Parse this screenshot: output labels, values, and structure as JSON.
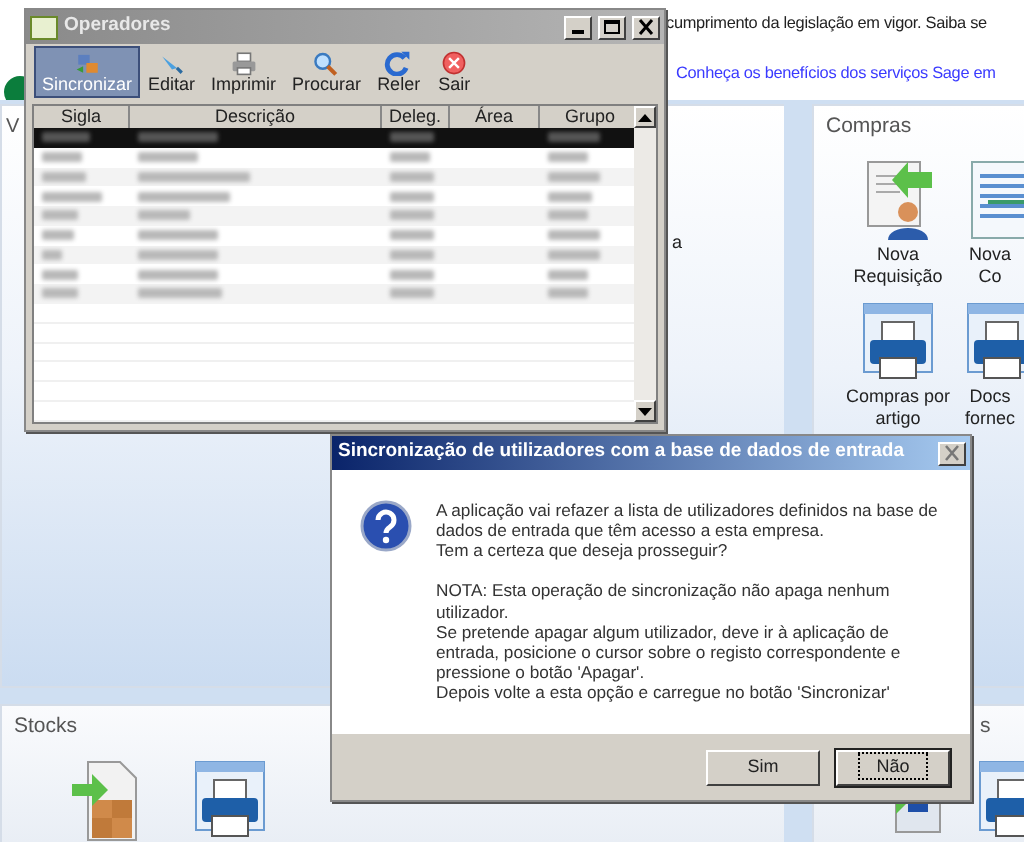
{
  "page": {
    "notice": "cumprimento da legislação em vigor. Saiba se",
    "link": "Conheça os benefícios dos serviços Sage em"
  },
  "panels": [
    {
      "title": "V",
      "items": [
        {
          "label": "a",
          "kind": "text"
        }
      ]
    },
    {
      "title": "Compras",
      "items": [
        {
          "label": "Nova Requisição",
          "kind": "request"
        },
        {
          "label": "Nova Co",
          "kind": "list"
        },
        {
          "label": "Compras por artigo",
          "kind": "printer"
        },
        {
          "label": "Docs fornec",
          "kind": "printer"
        }
      ]
    },
    {
      "title": "Stocks",
      "items": [
        {
          "kind": "stock"
        },
        {
          "kind": "printer"
        }
      ]
    },
    {
      "title": "s",
      "items": [
        {
          "kind": "warehouse"
        },
        {
          "kind": "printer"
        }
      ]
    }
  ],
  "operators_window": {
    "title": "Operadores",
    "toolbar": [
      {
        "label": "Sincronizar",
        "kind": "sync",
        "selected": true
      },
      {
        "label": "Editar",
        "kind": "edit",
        "selected": false
      },
      {
        "label": "Imprimir",
        "kind": "print",
        "selected": false
      },
      {
        "label": "Procurar",
        "kind": "search",
        "selected": false
      },
      {
        "label": "Reler",
        "kind": "reload",
        "selected": false
      },
      {
        "label": "Sair",
        "kind": "exit",
        "selected": false
      }
    ],
    "columns": [
      "Sigla",
      "Descrição",
      "Deleg.",
      "Área",
      "Grupo"
    ],
    "rows": [
      {
        "selected": true
      },
      {
        "selected": false
      },
      {
        "selected": false
      },
      {
        "selected": false
      },
      {
        "selected": false
      },
      {
        "selected": false
      },
      {
        "selected": false
      },
      {
        "selected": false
      },
      {
        "selected": false
      }
    ]
  },
  "dialog": {
    "title": "Sincronização de utilizadores com a base de dados de entrada",
    "message": [
      "A aplicação vai refazer a lista de utilizadores definidos na base de dados de entrada que têm acesso a esta empresa.",
      "Tem a certeza que deseja prosseguir?"
    ],
    "note": [
      "NOTA: Esta operação de sincronização não apaga nenhum utilizador.",
      "Se pretende apagar algum utilizador, deve ir à aplicação de entrada, posicione o cursor sobre o registo correspondente e pressione o botão 'Apagar'.",
      "Depois volte a esta opção e carregue no botão 'Sincronizar'"
    ],
    "buttons": [
      {
        "label": "Sim",
        "focused": false
      },
      {
        "label": "Não",
        "focused": true
      }
    ]
  }
}
